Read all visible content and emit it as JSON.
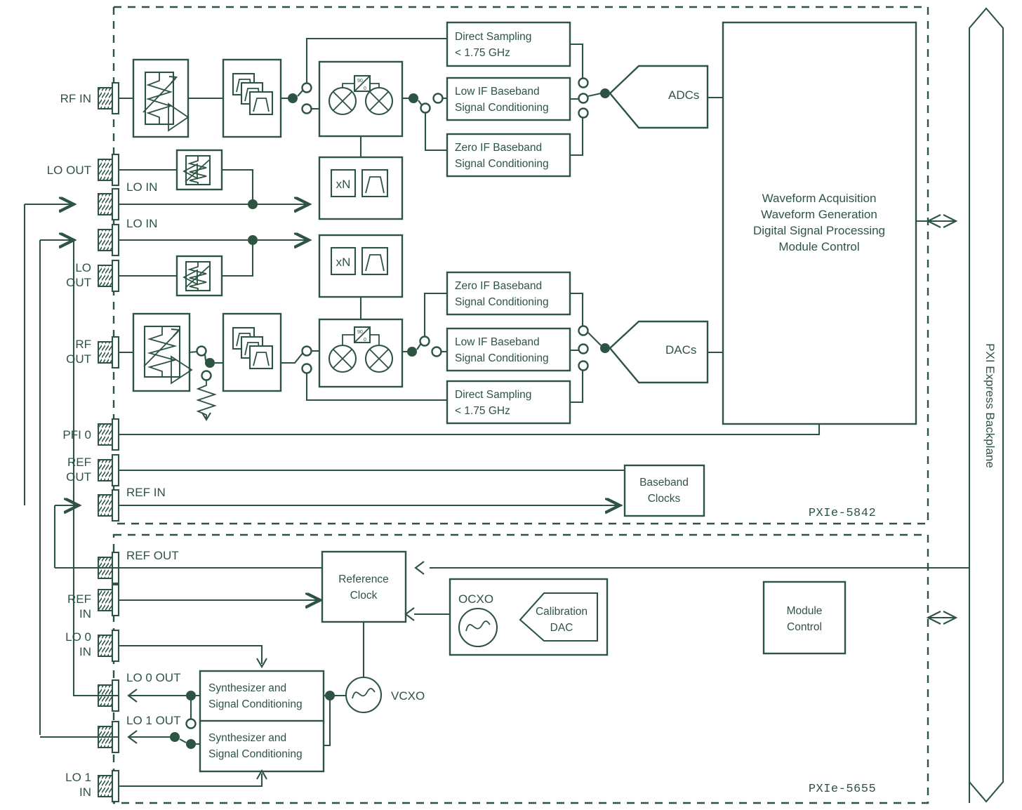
{
  "diagram": {
    "title": "PXIe-5842 / PXIe-5655 RF block diagram",
    "accent_color": "#2d5443",
    "background": "#ffffff"
  },
  "modules": [
    {
      "id": "pxie5842",
      "label": "PXIe-5842"
    },
    {
      "id": "pxie5655",
      "label": "PXIe-5655"
    }
  ],
  "backplane": {
    "label": "PXI Express Backplane"
  },
  "ports_5842": [
    {
      "name": "rf-in",
      "label": "RF IN",
      "label_lines": [
        "RF IN"
      ]
    },
    {
      "name": "lo-out-0",
      "label": "LO OUT",
      "label_lines": [
        "LO OUT"
      ]
    },
    {
      "name": "lo-in-0",
      "label": "LO IN",
      "label_lines": [
        "LO IN"
      ]
    },
    {
      "name": "lo-in-1",
      "label": "LO IN",
      "label_lines": [
        "LO IN"
      ]
    },
    {
      "name": "lo-out-1",
      "label": "LO OUT",
      "label_lines": [
        "LO",
        "OUT"
      ]
    },
    {
      "name": "rf-out",
      "label": "RF OUT",
      "label_lines": [
        "RF",
        "OUT"
      ]
    },
    {
      "name": "pfi-0",
      "label": "PFI 0",
      "label_lines": [
        "PFI 0"
      ]
    },
    {
      "name": "ref-out-5842",
      "label": "REF OUT",
      "label_lines": [
        "REF",
        "OUT"
      ]
    },
    {
      "name": "ref-in-5842",
      "label": "REF IN",
      "label_lines": [
        "REF IN"
      ]
    }
  ],
  "ports_5655": [
    {
      "name": "ref-out-5655",
      "label": "REF OUT",
      "label_lines": [
        "REF OUT"
      ]
    },
    {
      "name": "ref-in-5655",
      "label": "REF IN",
      "label_lines": [
        "REF",
        "IN"
      ]
    },
    {
      "name": "lo-0-in",
      "label": "LO 0 IN",
      "label_lines": [
        "LO 0",
        "IN"
      ]
    },
    {
      "name": "lo-0-out",
      "label": "LO 0 OUT",
      "label_lines": [
        "LO 0 OUT"
      ]
    },
    {
      "name": "lo-1-out",
      "label": "LO 1 OUT",
      "label_lines": [
        "LO 1 OUT"
      ]
    },
    {
      "name": "lo-1-in",
      "label": "LO 1 IN",
      "label_lines": [
        "LO 1",
        "IN"
      ]
    }
  ],
  "blocks_rx": {
    "direct_sampling": {
      "lines": [
        "Direct Sampling",
        "< 1.75 GHz"
      ]
    },
    "low_if": {
      "lines": [
        "Low IF Baseband",
        "Signal Conditioning"
      ]
    },
    "zero_if": {
      "lines": [
        "Zero IF Baseband",
        "Signal Conditioning"
      ]
    },
    "converters": {
      "label": "ADCs"
    }
  },
  "blocks_tx": {
    "zero_if": {
      "lines": [
        "Zero IF Baseband",
        "Signal Conditioning"
      ]
    },
    "low_if": {
      "lines": [
        "Low IF Baseband",
        "Signal Conditioning"
      ]
    },
    "direct_sampling": {
      "lines": [
        "Direct Sampling",
        "< 1.75 GHz"
      ]
    },
    "converters": {
      "label": "DACs"
    }
  },
  "fpga": {
    "lines": [
      "Waveform Acquisition",
      "Waveform Generation",
      "Digital Signal Processing",
      "Module Control"
    ]
  },
  "baseband_clocks": {
    "lines": [
      "Baseband",
      "Clocks"
    ]
  },
  "lo_multipliers": [
    {
      "name": "lo-mult-0",
      "multiplier": "xN"
    },
    {
      "name": "lo-mult-1",
      "multiplier": "xN"
    }
  ],
  "quadrature": {
    "top_label": "90",
    "bottom_label": "0"
  },
  "clock_section": {
    "reference_clock": {
      "lines": [
        "Reference",
        "Clock"
      ]
    },
    "ocxo": {
      "label": "OCXO"
    },
    "calibration_dac": {
      "lines": [
        "Calibration",
        "DAC"
      ]
    },
    "vcxo": {
      "label": "VCXO"
    },
    "module_control": {
      "lines": [
        "Module",
        "Control"
      ]
    },
    "synthesizers": [
      {
        "name": "synth-0",
        "lines": [
          "Synthesizer and",
          "Signal Conditioning"
        ]
      },
      {
        "name": "synth-1",
        "lines": [
          "Synthesizer and",
          "Signal Conditioning"
        ]
      }
    ]
  }
}
